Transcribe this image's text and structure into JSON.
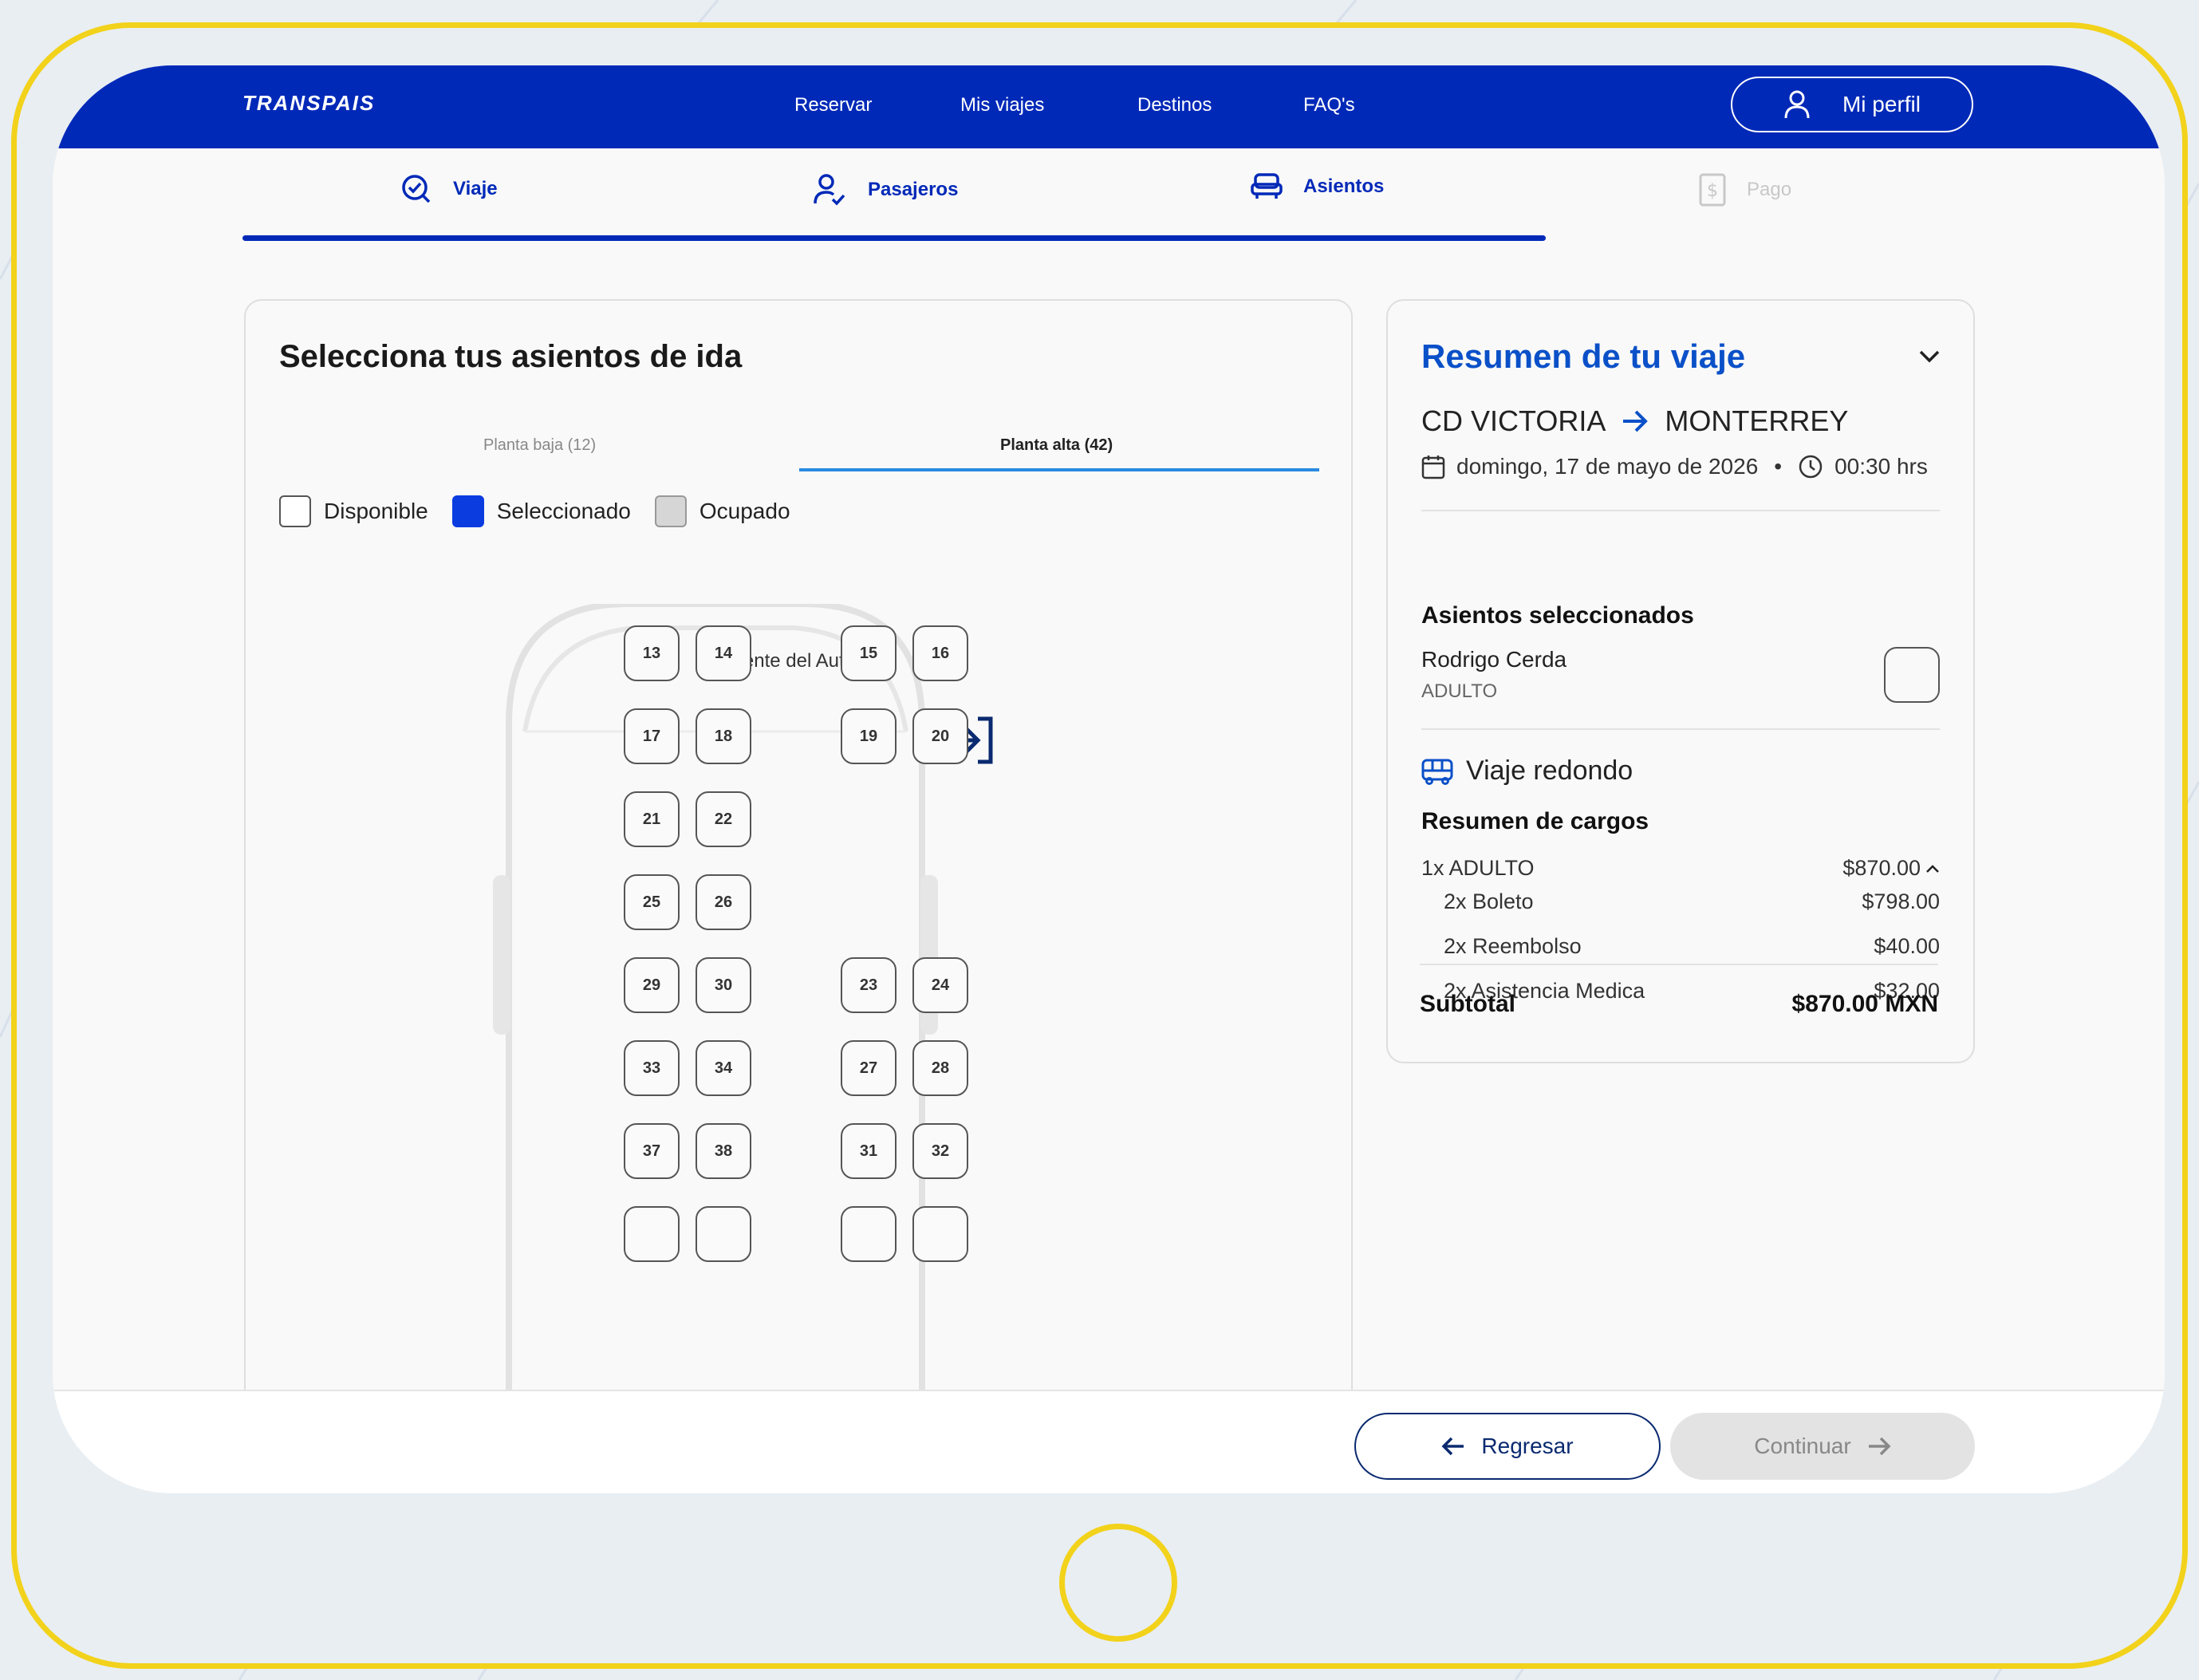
{
  "header": {
    "logo": "TRANSPAIS",
    "nav": [
      "Reservar",
      "Mis viajes",
      "Destinos",
      "FAQ's"
    ],
    "profile_label": "Mi perfil"
  },
  "steps": [
    {
      "label": "Viaje",
      "icon": "check-circle-icon",
      "state": "done"
    },
    {
      "label": "Pasajeros",
      "icon": "user-check-icon",
      "state": "done"
    },
    {
      "label": "Asientos",
      "icon": "seat-icon",
      "state": "active"
    },
    {
      "label": "Pago",
      "icon": "payment-icon",
      "state": "disabled"
    }
  ],
  "seats_panel": {
    "title": "Selecciona tus asientos de ida",
    "tabs": [
      {
        "label": "Planta baja (12)",
        "active": false
      },
      {
        "label": "Planta alta (42)",
        "active": true
      }
    ],
    "legend": [
      {
        "label": "Disponible",
        "color": "#ffffff"
      },
      {
        "label": "Seleccionado",
        "color": "#0a3ce0"
      },
      {
        "label": "Ocupado",
        "color": "#d6d6d6"
      }
    ],
    "bus_front_label": "Frente del Autobús",
    "seat_rows": [
      {
        "left": [
          "13",
          "14"
        ],
        "right": [
          "15",
          "16"
        ]
      },
      {
        "left": [
          "17",
          "18"
        ],
        "right": [
          "19",
          "20"
        ]
      },
      {
        "left": [
          "21",
          "22"
        ],
        "right": []
      },
      {
        "left": [
          "25",
          "26"
        ],
        "right": []
      },
      {
        "left": [
          "29",
          "30"
        ],
        "right": [
          "23",
          "24"
        ]
      },
      {
        "left": [
          "33",
          "34"
        ],
        "right": [
          "27",
          "28"
        ]
      },
      {
        "left": [
          "37",
          "38"
        ],
        "right": [
          "31",
          "32"
        ]
      }
    ]
  },
  "summary": {
    "title": "Resumen de tu viaje",
    "origin": "CD VICTORIA",
    "destination": "MONTERREY",
    "date": "domingo, 17 de mayo de 2026",
    "separator": "•",
    "time": "00:30 hrs",
    "selected_seats_title": "Asientos seleccionados",
    "passenger_name": "Rodrigo Cerda",
    "passenger_type": "ADULTO",
    "trip_type": "Viaje redondo",
    "charges_title": "Resumen de cargos",
    "charges": [
      {
        "label": "1x ADULTO",
        "amount": "$870.00",
        "sub": false
      },
      {
        "label": "2x Boleto",
        "amount": "$798.00",
        "sub": true
      },
      {
        "label": "2x Reembolso",
        "amount": "$40.00",
        "sub": true
      },
      {
        "label": "2x Asistencia Medica",
        "amount": "$32.00",
        "sub": true
      }
    ],
    "subtotal_label": "Subtotal",
    "subtotal_amount": "$870.00 MXN",
    "accent_color": "#0a50c8"
  },
  "footer": {
    "back_label": "Regresar",
    "continue_label": "Continuar"
  }
}
